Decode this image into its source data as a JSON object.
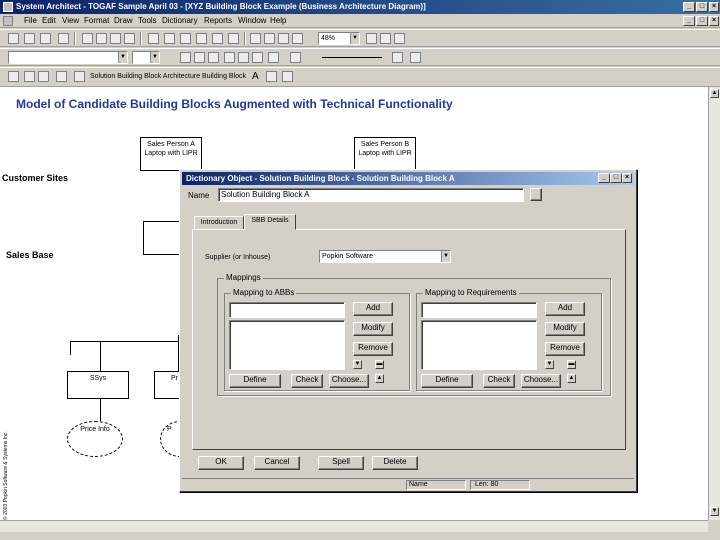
{
  "window": {
    "title": "System Architect - TOGAF Sample April 03 - [XYZ Building Block Example (Business Architecture Diagram)]"
  },
  "menu": [
    "File",
    "Edit",
    "View",
    "Format",
    "Draw",
    "Tools",
    "Dictionary",
    "Reports",
    "Window",
    "Help"
  ],
  "toolbar": {
    "zoom": "48%",
    "breadcrumb": "Solution Building Block  Architecture Building Block",
    "text_tool": "A"
  },
  "diagram": {
    "title": "Model of Candidate Building Blocks Augmented with Technical Functionality",
    "rows": {
      "customer_sites": "Customer Sites",
      "sales_base": "Sales Base"
    },
    "boxes": {
      "sales_a": [
        "Sales Person A",
        "Laptop with LIPR"
      ],
      "sales_b": [
        "Sales Person B",
        "Laptop with LIPR"
      ],
      "ssys": "SSys",
      "pr": "Pr"
    },
    "ellipses": {
      "price_info": "Price Info",
      "partial": "P"
    },
    "copyright": "© 2003 Popkin Software & Systems Inc."
  },
  "dialog": {
    "title": "Dictionary Object - Solution Building Block - Solution Building Block A",
    "name_label": "Name",
    "name_value": "Solution Building Block A",
    "tabs": [
      "Introduction",
      "SBB Details"
    ],
    "supplier_label": "Supplier (or Inhouse)",
    "supplier_value": "Popkin Software",
    "mappings_label": "Mappings",
    "abbs_group": "Mapping to ABBs",
    "req_group": "Mapping to Requirements",
    "add": "Add",
    "modify": "Modify",
    "remove": "Remove",
    "define": "Define",
    "check": "Check",
    "choose": "Choose...",
    "ok": "OK",
    "cancel": "Cancel",
    "spell": "Spell",
    "delete": "Delete",
    "status_name": "Name",
    "status_len": "Len: 80"
  }
}
